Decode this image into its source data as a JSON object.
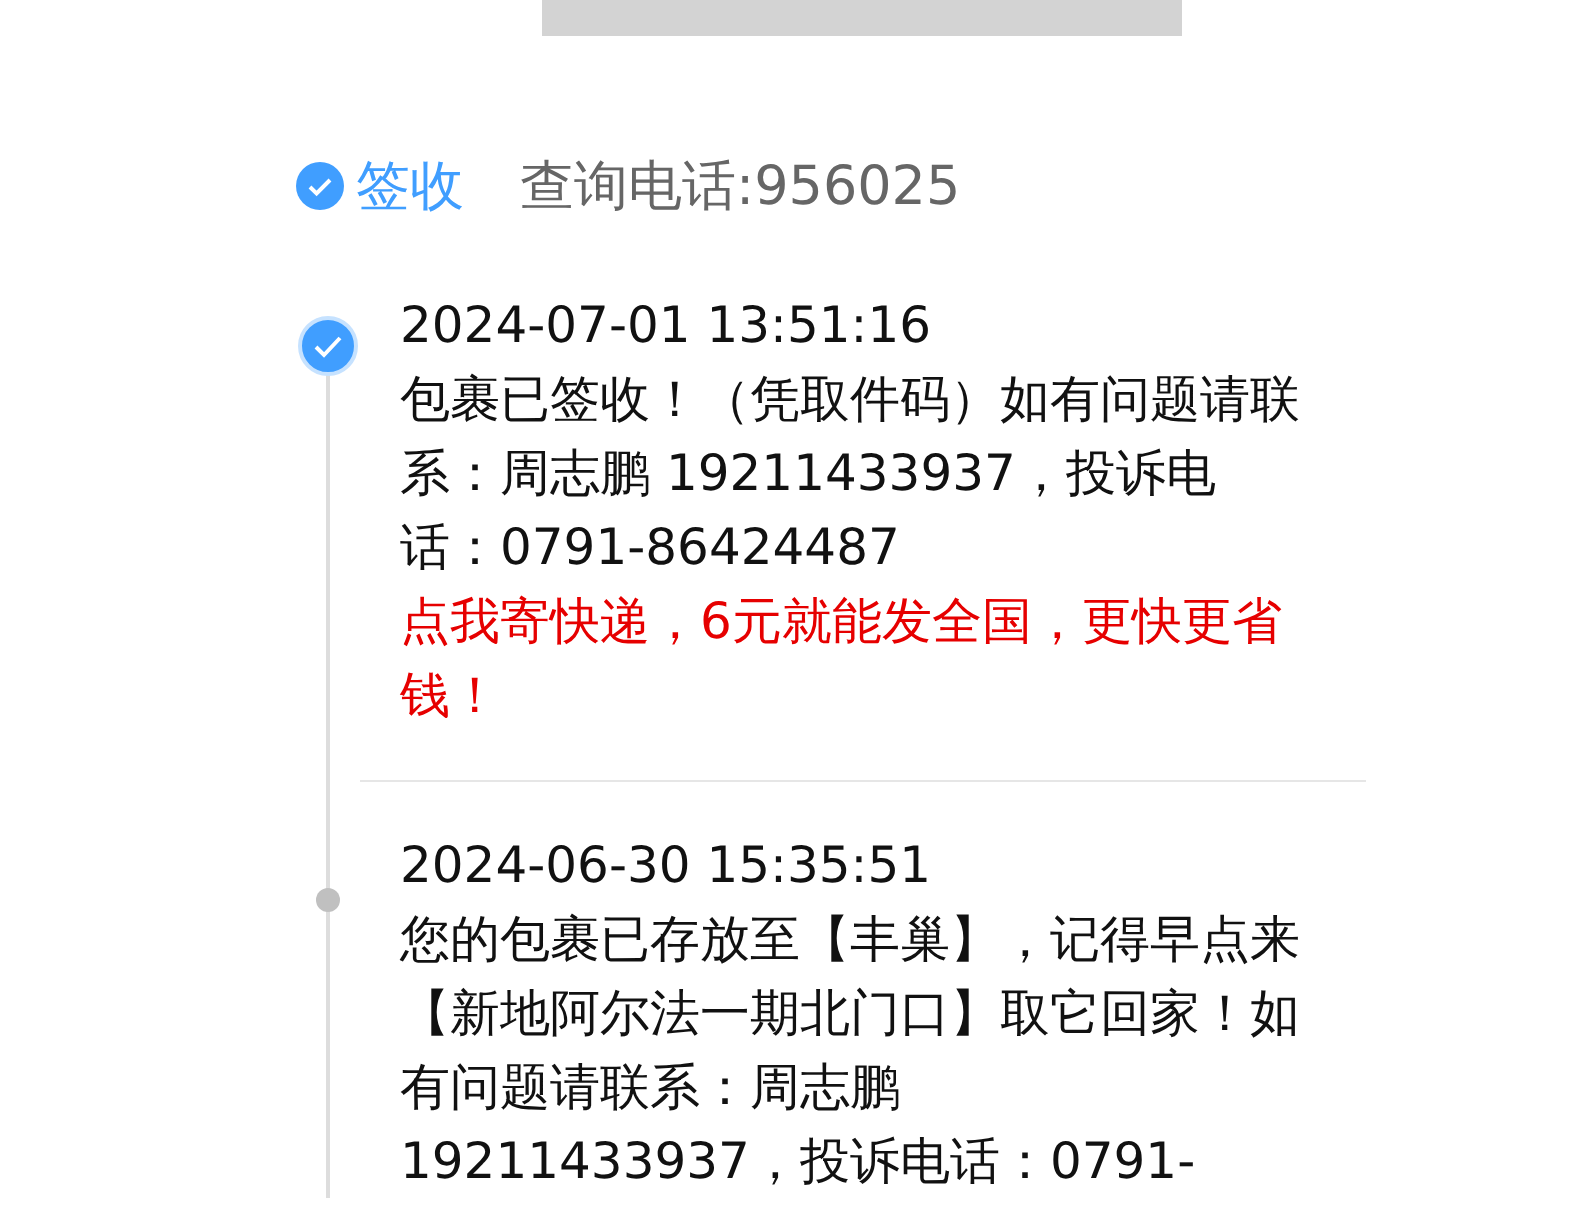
{
  "header": {
    "status": "签收",
    "phone": "查询电话:956025"
  },
  "events": [
    {
      "kind": "done",
      "time": "2024-07-01 13:51:16",
      "text": "包裹已签收！（凭取件码）如有问题请联系：周志鹏 19211433937，投诉电话：0791-86424487",
      "promo": "点我寄快递，6元就能发全国，更快更省钱！"
    },
    {
      "kind": "normal",
      "time": "2024-06-30 15:35:51",
      "text": "您的包裹已存放至【丰巢】，记得早点来【新地阿尔法一期北门口】取它回家！如有问题请联系：周志鹏 19211433937，投诉电话：0791-"
    }
  ]
}
